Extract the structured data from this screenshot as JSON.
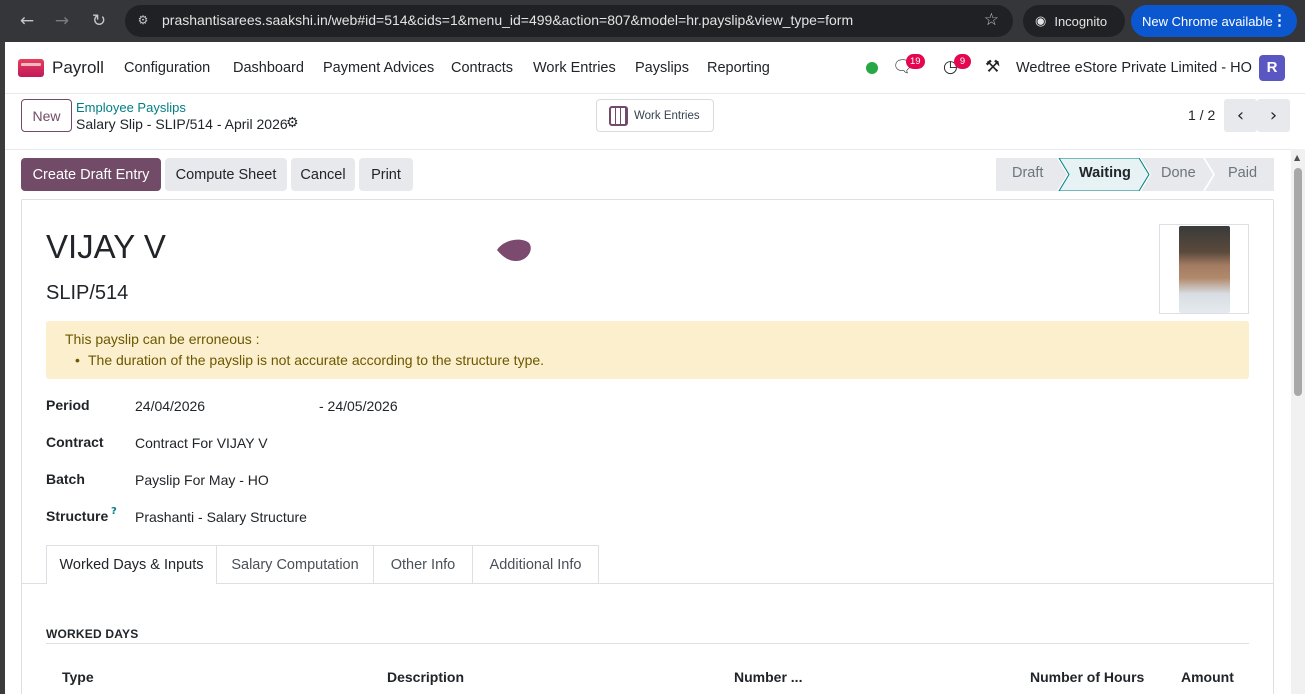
{
  "browser": {
    "url": "prashantisarees.saakshi.in/web#id=514&cids=1&menu_id=499&action=807&model=hr.payslip&view_type=form",
    "incognito_label": "Incognito",
    "update_label": "New Chrome available"
  },
  "navbar": {
    "app_name": "Payroll",
    "menu": [
      "Configuration",
      "Dashboard",
      "Payment Advices",
      "Contracts",
      "Work Entries",
      "Payslips",
      "Reporting"
    ],
    "messages_count": "19",
    "activities_count": "9",
    "company": "Wedtree eStore Private Limited - HO",
    "avatar_initial": "R"
  },
  "control_panel": {
    "new_label": "New",
    "breadcrumb_parent": "Employee Payslips",
    "breadcrumb_current": "Salary Slip - SLIP/514 - April 2026",
    "work_entries_label": "Work Entries",
    "pager": "1 / 2"
  },
  "actions": {
    "create_draft": "Create Draft Entry",
    "compute_sheet": "Compute Sheet",
    "cancel": "Cancel",
    "print": "Print"
  },
  "status": {
    "stages": [
      "Draft",
      "Waiting",
      "Done",
      "Paid"
    ],
    "current": "Waiting"
  },
  "form": {
    "employee_name": "VIJAY V",
    "reference": "SLIP/514",
    "alert_title": "This payslip can be erroneous :",
    "alert_item": "The duration of the payslip is not accurate according to the structure type.",
    "fields": {
      "period_label": "Period",
      "period_from": "24/04/2026",
      "period_to": "- 24/05/2026",
      "contract_label": "Contract",
      "contract_value": "Contract For VIJAY V",
      "batch_label": "Batch",
      "batch_value": "Payslip For May - HO",
      "structure_label": "Structure",
      "structure_help": "?",
      "structure_value": "Prashanti - Salary Structure"
    },
    "tabs": [
      "Worked Days & Inputs",
      "Salary Computation",
      "Other Info",
      "Additional Info"
    ],
    "section_title": "WORKED DAYS",
    "columns": [
      "Type",
      "Description",
      "Number ...",
      "Number of Hours",
      "Amount"
    ]
  },
  "colors": {
    "primary": "#714b67",
    "link": "#017e84",
    "warning_bg": "#fcefce",
    "badge": "#e4064e"
  }
}
